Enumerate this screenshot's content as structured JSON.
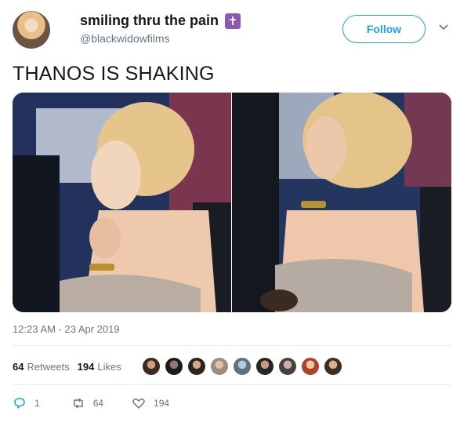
{
  "user": {
    "display_name": "smiling thru the pain",
    "handle": "@blackwidowfilms",
    "follow_label": "Follow"
  },
  "tweet": {
    "text": "THANOS IS SHAKING",
    "timestamp": "12:23 AM - 23 Apr 2019"
  },
  "stats": {
    "retweets_count": "64",
    "retweets_label": "Retweets",
    "likes_count": "194",
    "likes_label": "Likes"
  },
  "actions": {
    "reply_count": "1",
    "retweet_count": "64",
    "like_count": "194"
  },
  "colors": {
    "accent": "#1da1f2",
    "badge": "#8a58b5",
    "muted": "#657786"
  }
}
